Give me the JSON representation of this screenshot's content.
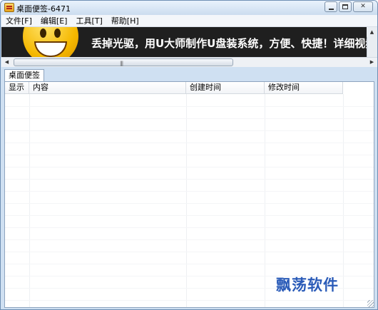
{
  "window": {
    "title": "桌面便签-6471"
  },
  "title_buttons": {
    "minimize_icon": "minimize-icon",
    "maximize_icon": "maximize-icon",
    "close_glyph": "✕"
  },
  "menu": {
    "items": [
      "文件[F]",
      "编辑[E]",
      "工具[T]",
      "帮助[H]"
    ]
  },
  "banner": {
    "text": "丢掉光驱，用U大师制作U盘装系统，方便、快捷！详细视频"
  },
  "scrollbar": {
    "left_arrow": "◀",
    "right_arrow": "▶",
    "grip": "|||",
    "up_arrow": "▲"
  },
  "tabs": [
    "桌面便签"
  ],
  "table": {
    "columns": [
      "显示",
      "内容",
      "创建时间",
      "修改时间"
    ]
  },
  "watermark": "飘荡软件"
}
